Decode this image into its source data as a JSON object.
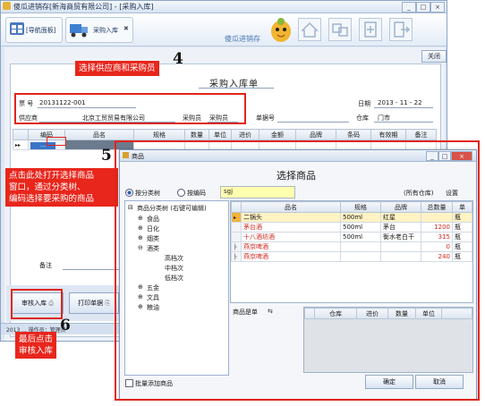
{
  "app": {
    "title": "傻瓜进销存[新海商贸有限公司] - [采购入库]",
    "window_controls": [
      "_",
      "□",
      "×"
    ]
  },
  "toolbar": {
    "nav_tab": "[导航面板]",
    "purchase_tab": "采购入库",
    "logo_text": "傻瓜进销存"
  },
  "form": {
    "close_button": "关闭",
    "title": "采购入库单",
    "fields": {
      "ticket_label": "票  号",
      "ticket_value": "20131122-001",
      "date_label": "日期",
      "date_value": "2013 - 11 - 22",
      "supplier_label": "供应商",
      "supplier_value": "北京工贸贸易有限公司",
      "buyer_label": "采购员",
      "buyer_value": "采购员",
      "doc_label": "单据号",
      "warehouse_label": "仓库",
      "warehouse_value": "门市"
    },
    "grid": {
      "columns": [
        "编码",
        "品名",
        "规格",
        "数量",
        "单位",
        "进价",
        "金额",
        "品牌",
        "条码",
        "有效期",
        "备注"
      ],
      "row_marker": "▸▸",
      "ellipsis": "…"
    },
    "remark_label": "备注"
  },
  "actions": {
    "audit_button": "审核入库",
    "print_button": "打印单据",
    "status_text": "2013 ... 操作员：管理员"
  },
  "callouts": {
    "c4": "选择供应商和采购员",
    "c5_lines": [
      "点击此处打开选择商品",
      "窗口，通过分类树、",
      "编码选择要采购的商品"
    ],
    "c6_lines": [
      "最后点击",
      "审核入库"
    ],
    "n4": "4",
    "n5": "5",
    "n6": "6"
  },
  "dialog": {
    "window_title": "商品",
    "heading": "选择商品",
    "radio_category": "按分类树",
    "radio_code": "按编码",
    "search_value": "sgj",
    "all_warehouses": "(所有仓库)",
    "settings": "设置",
    "tree": {
      "root": "商品分类树 (右键可编辑)",
      "nodes": [
        {
          "label": "食品",
          "level": 1,
          "sign": "⊕"
        },
        {
          "label": "日化",
          "level": 1,
          "sign": "⊕"
        },
        {
          "label": "烟类",
          "level": 1,
          "sign": "⊕"
        },
        {
          "label": "酒类",
          "level": 1,
          "sign": "⊖"
        },
        {
          "label": "高档次",
          "level": 2,
          "sign": ""
        },
        {
          "label": "中档次",
          "level": 2,
          "sign": ""
        },
        {
          "label": "低档次",
          "level": 2,
          "sign": ""
        },
        {
          "label": "五金",
          "level": 1,
          "sign": "⊕"
        },
        {
          "label": "文具",
          "level": 1,
          "sign": "⊕"
        },
        {
          "label": "粮油",
          "level": 1,
          "sign": "⊕"
        }
      ]
    },
    "product_grid": {
      "columns": [
        "品名",
        "规格",
        "品牌",
        "总数量",
        "单"
      ],
      "rows": [
        {
          "marker": "▸",
          "name": "二锅头",
          "spec": "500ml",
          "brand": "红星",
          "qty": "",
          "unit": "瓶",
          "red": false
        },
        {
          "marker": "",
          "name": "茅台酒",
          "spec": "500ml",
          "brand": "茅台",
          "qty": "1200",
          "unit": "瓶",
          "red": true
        },
        {
          "marker": "",
          "name": "十八酒坊酒",
          "spec": "500ml",
          "brand": "衡水老白干",
          "qty": "315",
          "unit": "瓶",
          "red": true
        },
        {
          "marker": "├",
          "name": "燕京啤酒",
          "spec": "",
          "brand": "",
          "qty": "0",
          "unit": "瓶",
          "red": true
        },
        {
          "marker": "├",
          "name": "燕京啤酒",
          "spec": "",
          "brand": "",
          "qty": "240",
          "unit": "瓶",
          "red": true
        }
      ]
    },
    "detail_label": "商品是单",
    "detail_columns": [
      "仓库",
      "进价",
      "数量",
      "单位"
    ],
    "batch_add": "批量添加商品",
    "ok": "确定",
    "cancel": "取消"
  },
  "colors": {
    "callout_red": "#e8261c",
    "highlight_red": "#e0251a",
    "quantity_red": "#d0281e"
  }
}
